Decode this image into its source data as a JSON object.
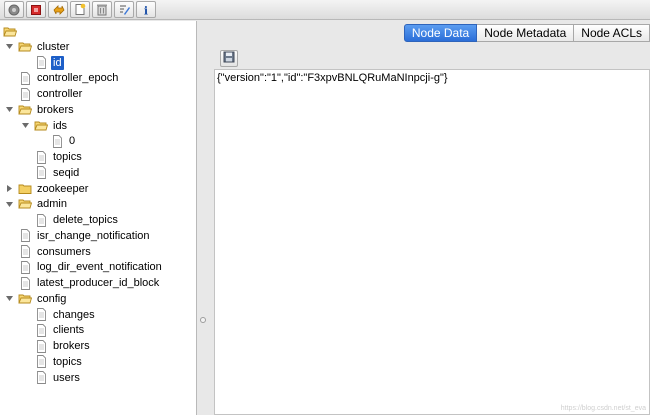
{
  "toolbar": {
    "buttons": [
      "connect-icon",
      "disconnect-icon",
      "refresh-icon",
      "add-node-icon",
      "delete-node-icon",
      "edit-icon",
      "info-icon"
    ]
  },
  "tree": {
    "root_icon": "folder-open-icon",
    "items": [
      {
        "label": "cluster",
        "type": "folder",
        "expanded": true,
        "depth": 0
      },
      {
        "label": "id",
        "type": "file",
        "depth": 1,
        "selected": true
      },
      {
        "label": "controller_epoch",
        "type": "file",
        "depth": 0
      },
      {
        "label": "controller",
        "type": "file",
        "depth": 0
      },
      {
        "label": "brokers",
        "type": "folder",
        "expanded": true,
        "depth": 0
      },
      {
        "label": "ids",
        "type": "folder",
        "expanded": true,
        "depth": 1
      },
      {
        "label": "0",
        "type": "file",
        "depth": 2
      },
      {
        "label": "topics",
        "type": "file",
        "depth": 1
      },
      {
        "label": "seqid",
        "type": "file",
        "depth": 1
      },
      {
        "label": "zookeeper",
        "type": "folder",
        "expanded": false,
        "depth": 0
      },
      {
        "label": "admin",
        "type": "folder",
        "expanded": true,
        "depth": 0
      },
      {
        "label": "delete_topics",
        "type": "file",
        "depth": 1
      },
      {
        "label": "isr_change_notification",
        "type": "file",
        "depth": 0
      },
      {
        "label": "consumers",
        "type": "file",
        "depth": 0
      },
      {
        "label": "log_dir_event_notification",
        "type": "file",
        "depth": 0
      },
      {
        "label": "latest_producer_id_block",
        "type": "file",
        "depth": 0
      },
      {
        "label": "config",
        "type": "folder",
        "expanded": true,
        "depth": 0
      },
      {
        "label": "changes",
        "type": "file",
        "depth": 1
      },
      {
        "label": "clients",
        "type": "file",
        "depth": 1
      },
      {
        "label": "brokers",
        "type": "file",
        "depth": 1
      },
      {
        "label": "topics",
        "type": "file",
        "depth": 1
      },
      {
        "label": "users",
        "type": "file",
        "depth": 1
      }
    ]
  },
  "tabs": [
    {
      "label": "Node Data",
      "active": true
    },
    {
      "label": "Node Metadata",
      "active": false
    },
    {
      "label": "Node ACLs",
      "active": false
    }
  ],
  "node_data": {
    "save_icon": "floppy-disk-icon",
    "content": "{\"version\":\"1\",\"id\":\"F3xpvBNLQRuMaNInpcji-g\"}"
  },
  "watermark": "https://blog.csdn.net/st_eva"
}
